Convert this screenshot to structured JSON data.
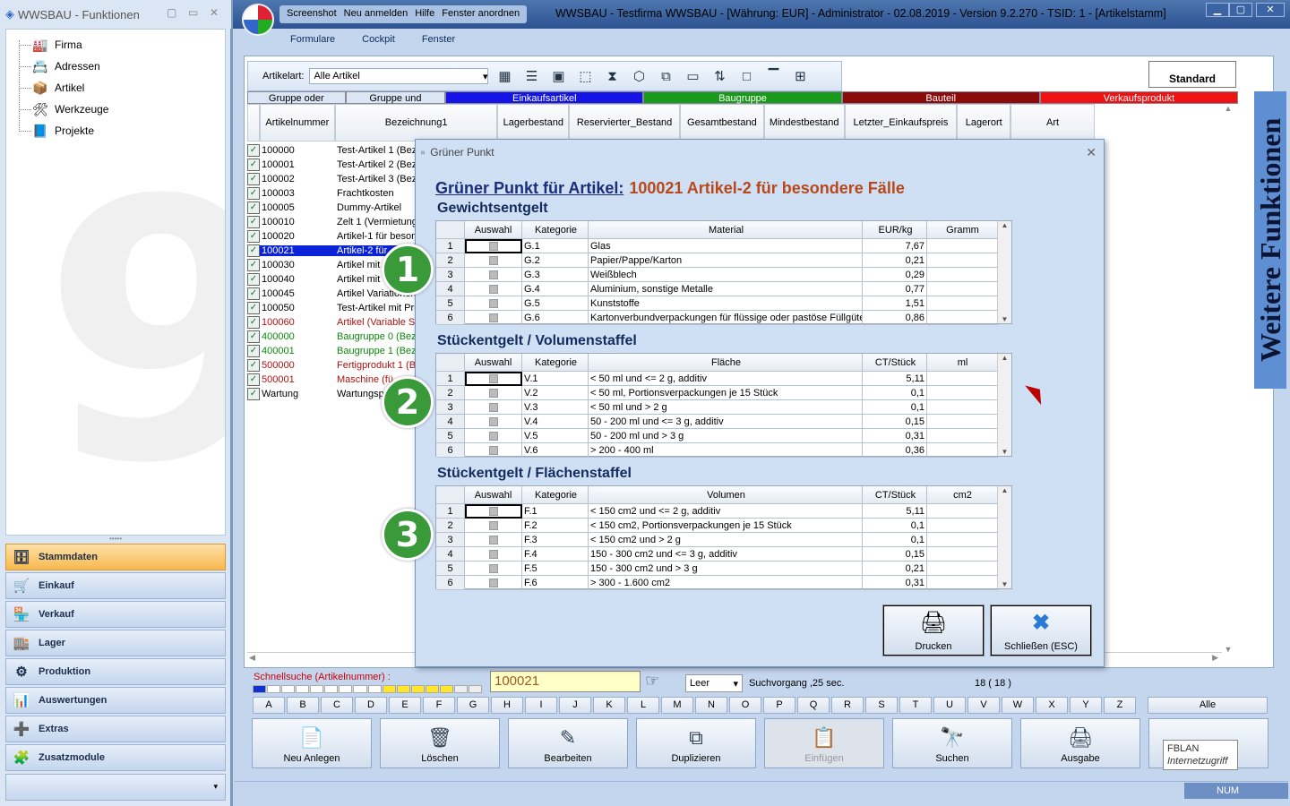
{
  "left": {
    "title": "WWSBAU - Funktionen",
    "tree": [
      {
        "label": "Firma",
        "icon": "factory-icon"
      },
      {
        "label": "Adressen",
        "icon": "address-card-icon"
      },
      {
        "label": "Artikel",
        "icon": "box-icon"
      },
      {
        "label": "Werkzeuge",
        "icon": "tools-icon"
      },
      {
        "label": "Projekte",
        "icon": "project-icon"
      }
    ],
    "nav": [
      "Stammdaten",
      "Einkauf",
      "Verkauf",
      "Lager",
      "Produktion",
      "Auswertungen",
      "Extras",
      "Zusatzmodule"
    ]
  },
  "titlebar": {
    "quick": [
      "Screenshot",
      "Neu anmelden",
      "Hilfe",
      "Fenster anordnen"
    ],
    "title": "WWSBAU - Testfirma WWSBAU - [Währung: EUR] - Administrator - 02.08.2019 - Version 9.2.270 - TSID: 1 - [Artikelstamm]"
  },
  "menu": [
    "Formulare",
    "Cockpit",
    "Fenster"
  ],
  "toolbar": {
    "artikelart_label": "Artikelart:",
    "artikelart_value": "Alle Artikel",
    "standard": "Standard"
  },
  "categories": [
    {
      "label": "Gruppe oder",
      "color": "#dbe6f4",
      "text": "#000"
    },
    {
      "label": "Gruppe und",
      "color": "#dbe6f4",
      "text": "#000"
    },
    {
      "label": "Einkaufsartikel",
      "color": "#1414e6",
      "text": "#fff"
    },
    {
      "label": "Baugruppe",
      "color": "#1a9a1a",
      "text": "#fff"
    },
    {
      "label": "Bauteil",
      "color": "#8b0a0a",
      "text": "#fff"
    },
    {
      "label": "Verkaufsprodukt",
      "color": "#ee1212",
      "text": "#fff"
    }
  ],
  "columns": [
    "Artikelnummer",
    "Bezeichnung1",
    "Lagerbestand",
    "Reservierter_Bestand",
    "Gesamtbestand",
    "Mindestbestand",
    "Letzter_Einkaufspreis",
    "Lagerort",
    "Art"
  ],
  "rows": [
    {
      "nr": "100000",
      "bez": "Test-Artikel 1 (Bez",
      "color": "#000"
    },
    {
      "nr": "100001",
      "bez": "Test-Artikel 2 (Bez",
      "color": "#000"
    },
    {
      "nr": "100002",
      "bez": "Test-Artikel 3 (Bez",
      "color": "#000"
    },
    {
      "nr": "100003",
      "bez": "Frachtkosten",
      "color": "#000"
    },
    {
      "nr": "100005",
      "bez": "Dummy-Artikel",
      "color": "#000"
    },
    {
      "nr": "100010",
      "bez": "Zelt 1 (Vermietung",
      "color": "#000"
    },
    {
      "nr": "100020",
      "bez": "Artikel-1 für beson",
      "color": "#000"
    },
    {
      "nr": "100021",
      "bez": "Artikel-2 für",
      "color": "#fff",
      "sel": true
    },
    {
      "nr": "100030",
      "bez": "Artikel mit S",
      "color": "#000"
    },
    {
      "nr": "100040",
      "bez": "Artikel mit V",
      "color": "#000"
    },
    {
      "nr": "100045",
      "bez": "Artikel Variationen",
      "color": "#000"
    },
    {
      "nr": "100050",
      "bez": "Test-Artikel mit Prü",
      "color": "#000"
    },
    {
      "nr": "100060",
      "bez": "Artikel (Variable Sti",
      "color": "#b01010"
    },
    {
      "nr": "400000",
      "bez": "Baugruppe 0 (Bez",
      "color": "#0a8a0a"
    },
    {
      "nr": "400001",
      "bez": "Baugruppe 1 (Bez",
      "color": "#0a8a0a"
    },
    {
      "nr": "500000",
      "bez": "Fertigprodukt 1 (B",
      "color": "#b01010"
    },
    {
      "nr": "500001",
      "bez": "Maschine (fü",
      "color": "#b01010"
    },
    {
      "nr": "Wartung",
      "bez": "Wartungsp",
      "color": "#000"
    }
  ],
  "side_tab": "Weitere Funktionen",
  "dialog": {
    "title": "Grüner Punkt",
    "heading_label": "Grüner Punkt für Artikel:",
    "heading_value": "100021  Artikel-2 für besondere Fälle",
    "print": "Drucken",
    "close": "Schließen (ESC)",
    "sections": [
      {
        "title": "Gewichtsentgelt",
        "badge": "1",
        "head": [
          "",
          "Auswahl",
          "Kategorie",
          "Material",
          "EUR/kg",
          "Gramm"
        ],
        "rows": [
          [
            "1",
            "G.1",
            "Glas",
            "7,67"
          ],
          [
            "2",
            "G.2",
            "Papier/Pappe/Karton",
            "0,21"
          ],
          [
            "3",
            "G.3",
            "Weißblech",
            "0,29"
          ],
          [
            "4",
            "G.4",
            "Aluminium, sonstige Metalle",
            "0,77"
          ],
          [
            "5",
            "G.5",
            "Kunststoffe",
            "1,51"
          ],
          [
            "6",
            "G.6",
            "Kartonverbundverpackungen für flüssige oder pastöse Füllgüter",
            "0,86"
          ]
        ]
      },
      {
        "title": "Stückentgelt / Volumenstaffel",
        "badge": "2",
        "head": [
          "",
          "Auswahl",
          "Kategorie",
          "Fläche",
          "CT/Stück",
          "ml"
        ],
        "rows": [
          [
            "1",
            "V.1",
            "< 50 ml und <= 2 g, additiv",
            "5,11"
          ],
          [
            "2",
            "V.2",
            "< 50 ml, Portionsverpackungen je 15 Stück",
            "0,1"
          ],
          [
            "3",
            "V.3",
            "< 50 ml und > 2 g",
            "0,1"
          ],
          [
            "4",
            "V.4",
            "50 - 200 ml und <= 3 g, additiv",
            "0,15"
          ],
          [
            "5",
            "V.5",
            "50 - 200 ml und > 3 g",
            "0,31"
          ],
          [
            "6",
            "V.6",
            "> 200 - 400 ml",
            "0,36"
          ]
        ]
      },
      {
        "title": "Stückentgelt / Flächenstaffel",
        "badge": "3",
        "head": [
          "",
          "Auswahl",
          "Kategorie",
          "Volumen",
          "CT/Stück",
          "cm2"
        ],
        "rows": [
          [
            "1",
            "F.1",
            "< 150 cm2 und <= 2 g, additiv",
            "5,11"
          ],
          [
            "2",
            "F.2",
            "< 150 cm2, Portionsverpackungen je 15 Stück",
            "0,1"
          ],
          [
            "3",
            "F.3",
            "< 150 cm2 und > 2 g",
            "0,1"
          ],
          [
            "4",
            "F.4",
            "150 - 300 cm2 und <= 3 g, additiv",
            "0,15"
          ],
          [
            "5",
            "F.5",
            "150 - 300 cm2 und > 3 g",
            "0,21"
          ],
          [
            "6",
            "F.6",
            "> 300 - 1.600 cm2",
            "0,31"
          ]
        ]
      }
    ]
  },
  "bottom": {
    "schnellsuche_label": "Schnellsuche (Artikelnummer) :",
    "schnellsuche_value": "100021",
    "leer": "Leer",
    "suchvorgang": "Suchvorgang ,25 sec.",
    "count": "18  ( 18 )",
    "letters": [
      "A",
      "B",
      "C",
      "D",
      "E",
      "F",
      "G",
      "H",
      "I",
      "J",
      "K",
      "L",
      "M",
      "N",
      "O",
      "P",
      "Q",
      "R",
      "S",
      "T",
      "U",
      "V",
      "W",
      "X",
      "Y",
      "Z"
    ],
    "alle": "Alle",
    "buttons": [
      {
        "label": "Neu Anlegen",
        "icon": "new-document-icon",
        "glyph": "📄"
      },
      {
        "label": "Löschen",
        "icon": "recycle-bin-icon",
        "glyph": "🗑"
      },
      {
        "label": "Bearbeiten",
        "icon": "edit-icon",
        "glyph": "✎"
      },
      {
        "label": "Duplizieren",
        "icon": "duplicate-icon",
        "glyph": "⧉"
      },
      {
        "label": "Einfügen",
        "icon": "paste-icon",
        "glyph": "📋",
        "disabled": true
      },
      {
        "label": "Suchen",
        "icon": "binoculars-icon",
        "glyph": "🔭"
      },
      {
        "label": "Ausgabe",
        "icon": "printer-icon",
        "glyph": "🖨"
      },
      {
        "label": "",
        "icon": "close-icon",
        "glyph": "✖"
      }
    ],
    "tooltip_line1": "FBLAN",
    "tooltip_line2": "Internetzugriff",
    "status_num": "NUM"
  }
}
